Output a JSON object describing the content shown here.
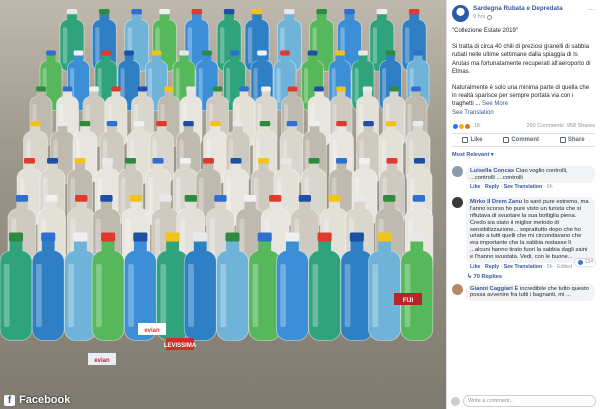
{
  "photo": {
    "watermark": "Facebook",
    "bottle_labels": [
      "evian",
      "LEVISSIMA",
      "FIJI",
      "evian"
    ]
  },
  "post": {
    "page_name": "Sardegna Rubata e Depredata",
    "time": "9 hrs",
    "title_quote": "\"Collezione Estate 2019\"",
    "paragraph1": "Si tratta di circa 40 chili di preziosi granelli di sabbia rubati nelle ultime settimane dalla spiaggia di Is Arutas ma fortunatamente recuperati all'aeroporto di Elmas.",
    "paragraph2_start": "Naturalmente è solo una minima parte di quella che in realtà sparisce per sempre portata via con i traghetti ...",
    "see_more": "See More",
    "see_translation": "See Translation",
    "reaction_count": "1K",
    "comments_count": "290 Comments",
    "shares_count": "958 Shares",
    "actions": {
      "like": "Like",
      "comment": "Comment",
      "share": "Share"
    },
    "most_relevant": "Most Relevant ▾"
  },
  "comments": [
    {
      "name": "Luisella Concas",
      "text": "Ciao voglio controlli, ...controlli ....controlli",
      "meta": {
        "like": "Like",
        "reply": "Reply",
        "translation": "See Translation",
        "time": "6h"
      },
      "avatar_color": "#8a9bb0"
    },
    {
      "name": "Mirko Il Drem Zanu",
      "text": "Io sarò pure estremo, ma l'anno scorso ho pure visto un turista che si rifiutava di svuotare la sua bottiglia piena. Credo sia stato il miglior metodo di sensibilizzazione... soprattutto dopo che ho urlato a tutti quelli che mi circondavano che era importante che la sabbia restasse lì ...alcuni hanno tirato fuori la sabbia dagli zaini e l'hanno svuotata. Vedi, con le buone...",
      "meta": {
        "like": "Like",
        "reply": "Reply",
        "translation": "See Translation",
        "time": "5h",
        "edited": "Edited"
      },
      "likes": "134",
      "replies": "70 Replies",
      "avatar_color": "#3a3a3a"
    },
    {
      "name": "Gianni Caggiari",
      "text": "È incredibile che tutto questo possa avvenire fra tutti i bagnanti, mi ...",
      "avatar_color": "#b48a66"
    }
  ],
  "write_placeholder": "Write a comment...",
  "colors": {
    "facebook_blue": "#365899",
    "like_blue": "#2078f4",
    "meta_gray": "#90949c"
  }
}
